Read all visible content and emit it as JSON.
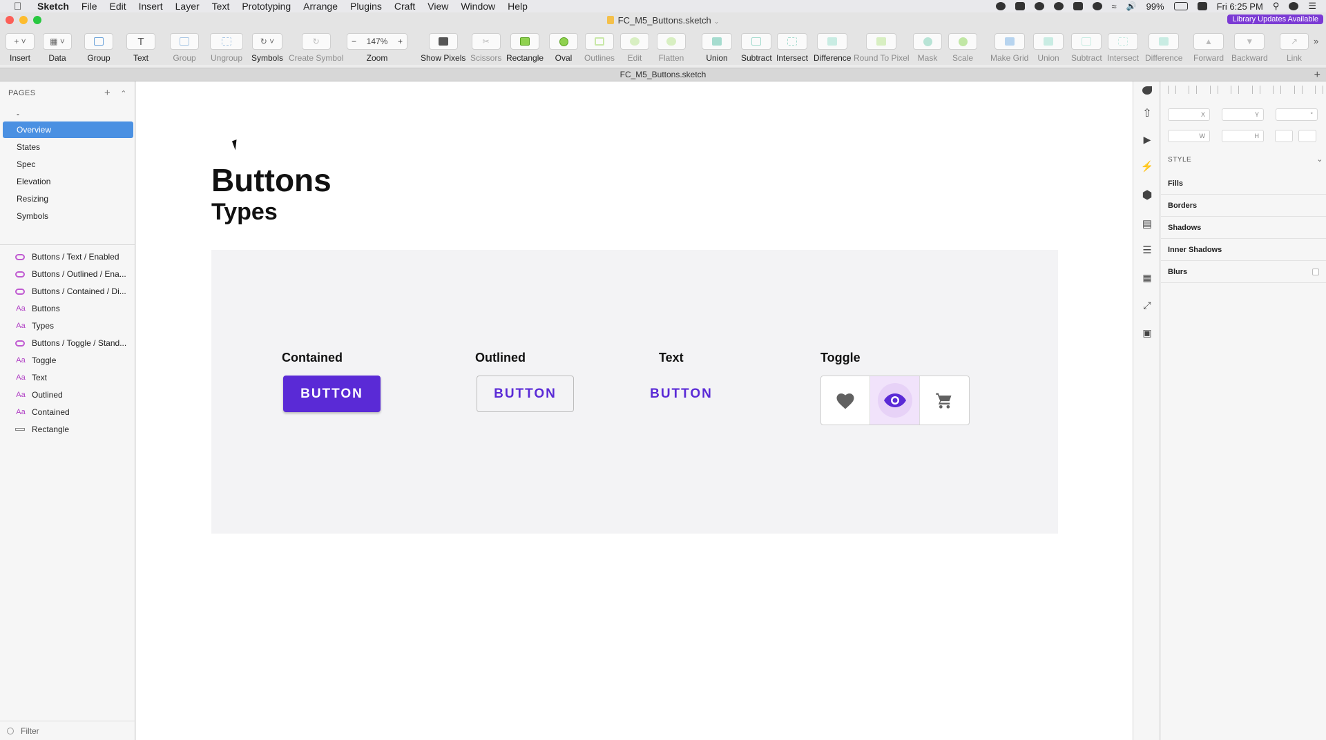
{
  "menubar": {
    "app": "Sketch",
    "items": [
      "File",
      "Edit",
      "Insert",
      "Layer",
      "Text",
      "Prototyping",
      "Arrange",
      "Plugins",
      "Craft",
      "View",
      "Window",
      "Help"
    ],
    "battery": "99%",
    "clock": "Fri 6:25 PM"
  },
  "window": {
    "title": "FC_M5_Buttons.sketch",
    "library_badge": "Library Updates Available",
    "tab": "FC_M5_Buttons.sketch"
  },
  "toolbar": {
    "insert": "Insert",
    "data": "Data",
    "group": "Group",
    "text": "Text",
    "group2": "Group",
    "ungroup": "Ungroup",
    "symbols": "Symbols",
    "create_symbol": "Create Symbol",
    "zoom_value": "147%",
    "zoom": "Zoom",
    "show_pixels": "Show Pixels",
    "scissors": "Scissors",
    "rectangle": "Rectangle",
    "oval": "Oval",
    "outlines": "Outlines",
    "edit": "Edit",
    "flatten": "Flatten",
    "union": "Union",
    "subtract": "Subtract",
    "intersect": "Intersect",
    "difference": "Difference",
    "round_to_pixel": "Round To Pixel",
    "mask": "Mask",
    "scale": "Scale",
    "make_grid": "Make Grid",
    "union2": "Union",
    "subtract2": "Subtract",
    "intersect2": "Intersect",
    "difference2": "Difference",
    "forward": "Forward",
    "backward": "Backward",
    "link": "Link"
  },
  "sidebar": {
    "pages_header": "PAGES",
    "pages": [
      "-",
      "Overview",
      "States",
      "Spec",
      "Elevation",
      "Resizing",
      "Symbols"
    ],
    "selected_page": "Overview",
    "layers": [
      {
        "label": "Buttons / Text / Enabled",
        "icon": "symbol-icon"
      },
      {
        "label": "Buttons / Outlined / Ena...",
        "icon": "symbol-icon"
      },
      {
        "label": "Buttons / Contained / Di...",
        "icon": "symbol-icon"
      },
      {
        "label": "Buttons",
        "icon": "text-layer-icon"
      },
      {
        "label": "Types",
        "icon": "text-layer-icon"
      },
      {
        "label": "Buttons / Toggle / Stand...",
        "icon": "symbol-icon"
      },
      {
        "label": "Toggle",
        "icon": "text-layer-icon"
      },
      {
        "label": "Text",
        "icon": "text-layer-icon"
      },
      {
        "label": "Outlined",
        "icon": "text-layer-icon"
      },
      {
        "label": "Contained",
        "icon": "text-layer-icon"
      },
      {
        "label": "Rectangle",
        "icon": "rectangle-icon"
      }
    ],
    "text_icon_glyph": "Aa",
    "filter": "Filter"
  },
  "canvas": {
    "title": "Buttons",
    "subtitle": "Types",
    "labels": {
      "contained": "Contained",
      "outlined": "Outlined",
      "text": "Text",
      "toggle": "Toggle"
    },
    "button_label": "BUTTON",
    "accent": "#5a2ad6"
  },
  "inspector": {
    "x_label": "X",
    "y_label": "Y",
    "rot_label": "°",
    "w_label": "W",
    "h_label": "H",
    "style_header": "STYLE",
    "sections": [
      "Fills",
      "Borders",
      "Shadows",
      "Inner Shadows",
      "Blurs"
    ]
  }
}
